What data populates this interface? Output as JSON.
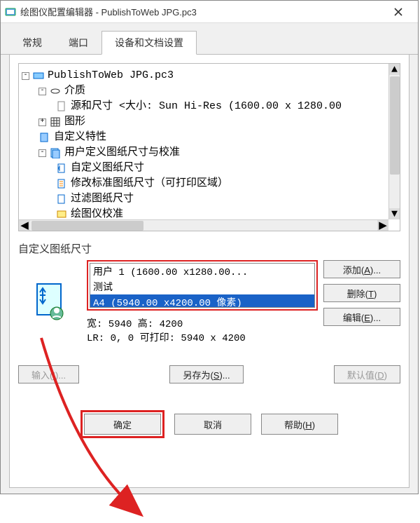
{
  "title": "绘图仪配置编辑器 - PublishToWeb JPG.pc3",
  "tabs": {
    "general": "常规",
    "ports": "端口",
    "device": "设备和文档设置"
  },
  "tree": {
    "root": "PublishToWeb JPG.pc3",
    "media": "介质",
    "source_size": "源和尺寸 <大小: Sun Hi-Res (1600.00 x 1280.00",
    "graphics": "图形",
    "custom_props": "自定义特性",
    "user_paper": "用户定义图纸尺寸与校准",
    "custom_paper_size": "自定义图纸尺寸",
    "modify_std": "修改标准图纸尺寸（可打印区域）",
    "filter_paper": "过滤图纸尺寸",
    "plotter_cal": "绘图仪校准"
  },
  "section": {
    "label": "自定义图纸尺寸"
  },
  "paperlist": {
    "items": [
      "用户 1 (1600.00 x1280.00...",
      "测试",
      "A4 (5940.00 x4200.00 像素)"
    ],
    "selected_index": 2
  },
  "paper_info": {
    "line1": "宽: 5940 高: 4200",
    "line2": "LR: 0, 0 可打印: 5940 x 4200"
  },
  "buttons": {
    "add": "添加(<u>A</u>)...",
    "delete": "删除(<u>T</u>)",
    "edit": "编辑(<u>E</u>)...",
    "import": "输入(<u>I</u>)...",
    "save_as": "另存为(<u>S</u>)...",
    "defaults": "默认值(<u>D</u>)",
    "ok": "确定",
    "cancel": "取消",
    "help": "帮助(<u>H</u>)"
  }
}
